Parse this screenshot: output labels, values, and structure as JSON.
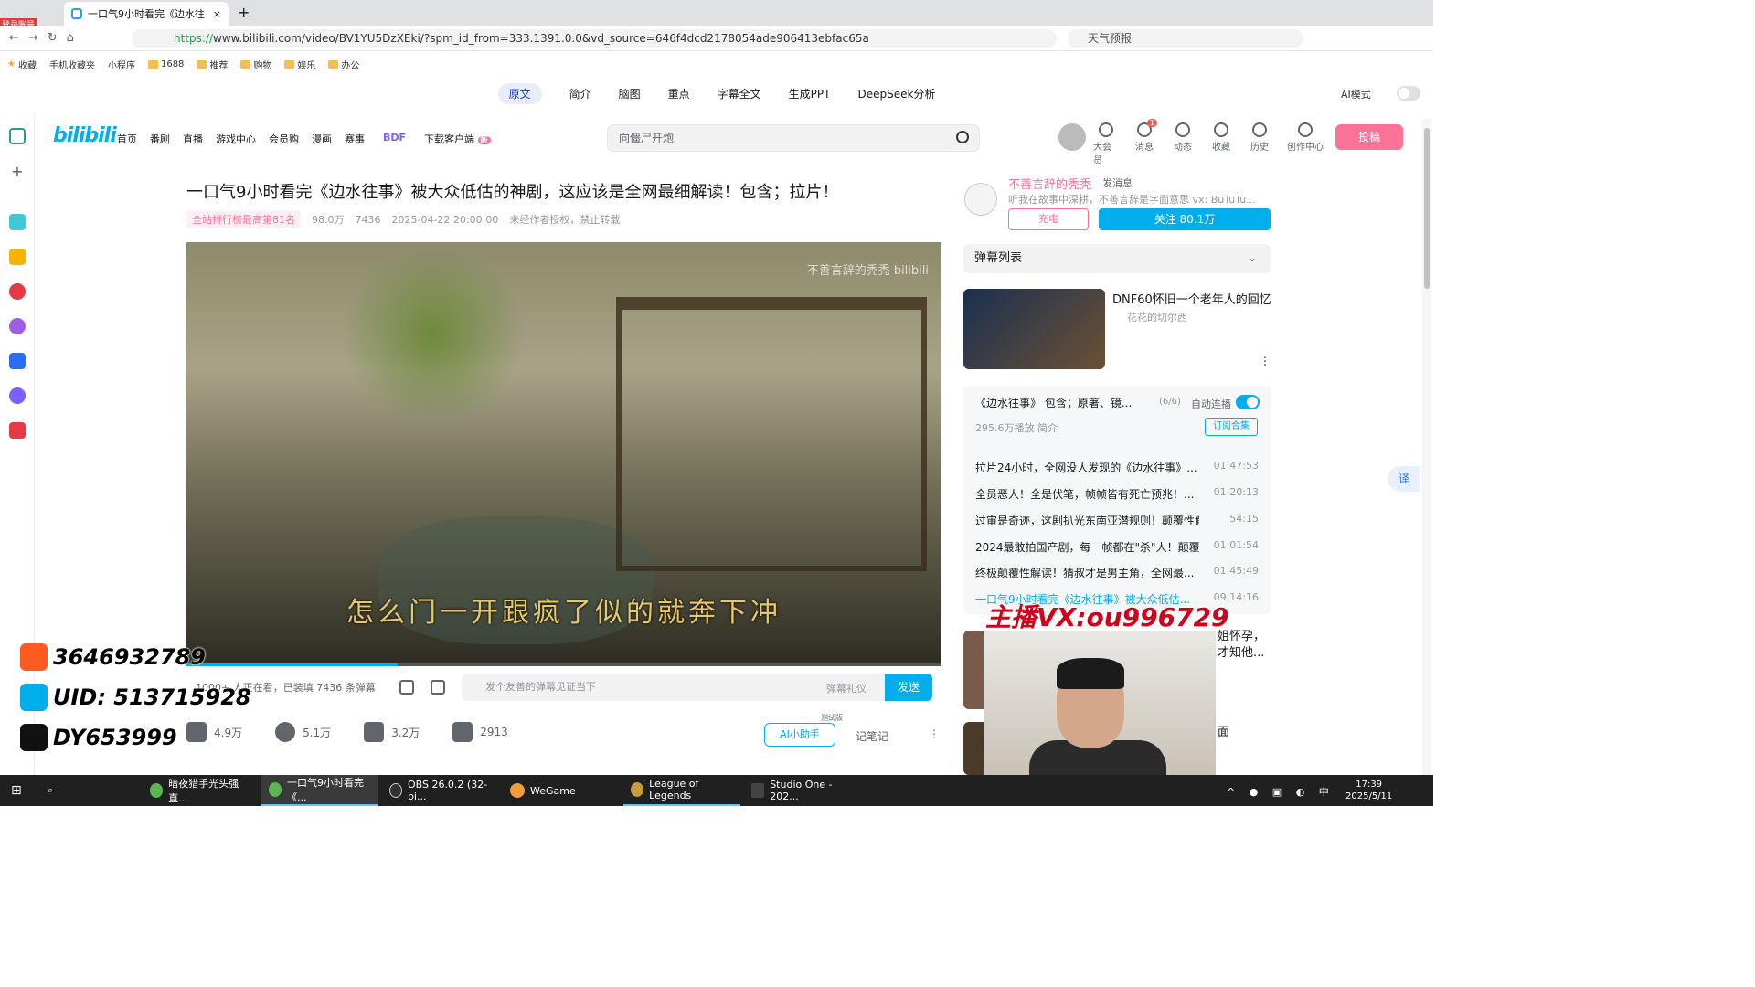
{
  "browser": {
    "tab_title": "一口气9小时看完《边水往",
    "url_prefix": "https://",
    "url_rest": "www.bilibili.com/video/BV1YU5DzXEki/?spm_id_from=333.1391.0.0&vd_source=646f4dcd2178054ade906413ebfac65a",
    "search_placeholder": "天气预报",
    "login_badge": "登录账号",
    "bookmarks": [
      "收藏",
      "手机收藏夹",
      "小程序",
      "1688",
      "推荐",
      "购物",
      "娱乐",
      "办公"
    ]
  },
  "ai_toolbar": {
    "items": [
      "原文",
      "简介",
      "脑图",
      "重点",
      "字幕全文",
      "生成PPT",
      "DeepSeek分析"
    ],
    "mode_label": "AI模式"
  },
  "bili_header": {
    "logo": "bilibili",
    "nav": [
      "首页",
      "番剧",
      "直播",
      "游戏中心",
      "会员购",
      "漫画",
      "赛事",
      "BDF",
      "下载客户端"
    ],
    "download_badge": "新",
    "search_placeholder": "向僵尸开炮",
    "icons": [
      "大会员",
      "消息",
      "动态",
      "收藏",
      "历史",
      "创作中心"
    ],
    "message_count": "1",
    "upload_label": "投稿"
  },
  "video": {
    "title": "一口气9小时看完《边水往事》被大众低估的神剧，这应该是全网最细解读！包含；拉片！",
    "rank": "全站排行榜最高第81名",
    "views": "98.0万",
    "danmaku_count": "7436",
    "date": "2025-04-22 20:00:00",
    "copyright": "未经作者授权，禁止转载",
    "watermark": "不善言辞的秃秃 bilibili",
    "subtitle": "怎么门一开跟疯了似的就奔下冲",
    "progress": 0.28,
    "viewers_text": "1000+ 人正在看，已装填 7436 条弹幕",
    "danmaku_placeholder": "发个友善的弹幕见证当下",
    "danmaku_gift": "弹幕礼仪",
    "send_label": "发送",
    "likes": "4.9万",
    "coins": "5.1万",
    "favorites": "3.2万",
    "shares": "2913",
    "ai_assistant": "AI小助手",
    "ai_assistant_tag": "测试版",
    "notes": "记笔记"
  },
  "uploader": {
    "name": "不善言辞的秃秃",
    "message": "发消息",
    "desc": "听我在故事中深耕，不善言辞是字面意思 vx: BuTuTu...",
    "charge": "充电",
    "follow": "关注 80.1万"
  },
  "danmaku_list_title": "弹幕列表",
  "recommend": {
    "title": "DNF60怀旧一个老年人的回忆",
    "author": "花花的切尔西"
  },
  "playlist": {
    "title": "《边水往事》 包含；原著、镜...",
    "count": "(6/6)",
    "autoplay": "自动连播",
    "plays": "295.6万播放",
    "intro": "简介",
    "subscribe": "订阅合集",
    "episodes": [
      {
        "title": "拉片24小时，全网没人发现的《边水往事》...",
        "dur": "01:47:53"
      },
      {
        "title": "全员恶人！全是伏笔，帧帧皆有死亡预兆！...",
        "dur": "01:20:13"
      },
      {
        "title": "过审是奇迹，这剧扒光东南亚潜规则！颠覆性解...",
        "dur": "54:15"
      },
      {
        "title": "2024最敢拍国产剧，每一帧都在\"杀\"人！颠覆...",
        "dur": "01:01:54"
      },
      {
        "title": "终极颠覆性解读！猜叔才是男主角，全网最...",
        "dur": "01:45:49"
      },
      {
        "title": "一口气9小时看完《边水往事》被大众低估...",
        "dur": "09:14:16"
      }
    ]
  },
  "stream_overlay": {
    "vx": "主播VX:ou996729",
    "kuaishou": "3646932789",
    "uid": "UID: 513715928",
    "douyin": "DY653999",
    "behind_text1": "姐怀孕，",
    "behind_text2": "才知他...",
    "behind_text3": "面"
  },
  "translate": "译",
  "taskbar": {
    "items": [
      "暗夜猎手光头强直...",
      "一口气9小时看完《...",
      "OBS 26.0.2 (32-bi...",
      "WeGame",
      "League of Legends",
      "Studio One - 202..."
    ],
    "time": "17:39",
    "date": "2025/5/11",
    "ime": "中"
  }
}
